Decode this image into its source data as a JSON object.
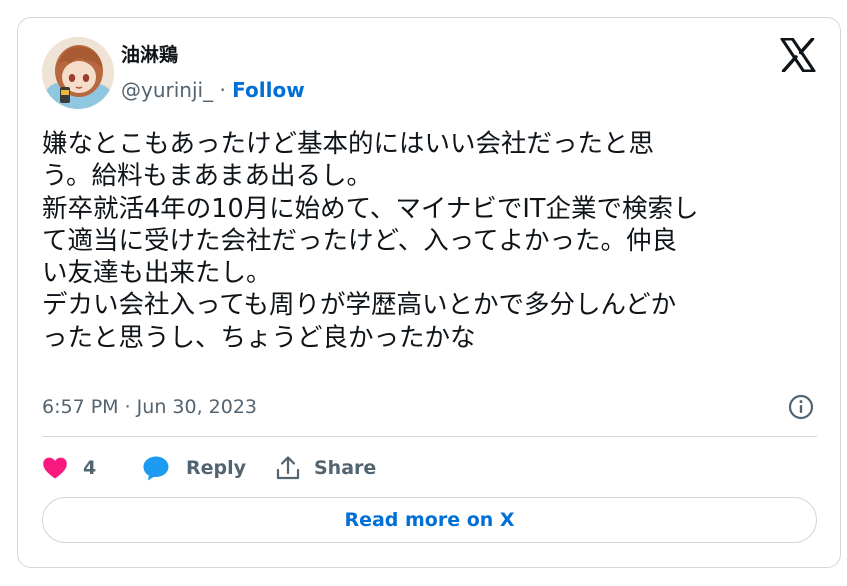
{
  "author": {
    "display_name": "油淋鶏",
    "handle": "@yurinji_",
    "separator": " · ",
    "follow_label": "Follow"
  },
  "tweet": {
    "lines": [
      "嫌なとこもあったけど基本的にはいい会社だったと思",
      "う。給料もまあまあ出るし。",
      "新卒就活4年の10月に始めて、マイナビでIT企業で検索し",
      "て適当に受けた会社だったけど、入ってよかった。仲良",
      "い友達も出来たし。",
      "デカい会社入っても周りが学歴高いとかで多分しんどか",
      "ったと思うし、ちょうど良かったかな"
    ],
    "timestamp": "6:57 PM · Jun 30, 2023"
  },
  "actions": {
    "like_count": "4",
    "reply_label": "Reply",
    "share_label": "Share",
    "read_more_label": "Read more on X"
  },
  "icons": {
    "brand": "x-logo-icon",
    "info": "info-icon",
    "like": "heart-icon",
    "reply": "speech-bubble-icon",
    "share": "share-upload-icon"
  },
  "colors": {
    "link": "#006fd6",
    "like": "#f91880",
    "reply": "#1d9bf0",
    "muted_text": "#536471",
    "border": "#cfd9de"
  }
}
